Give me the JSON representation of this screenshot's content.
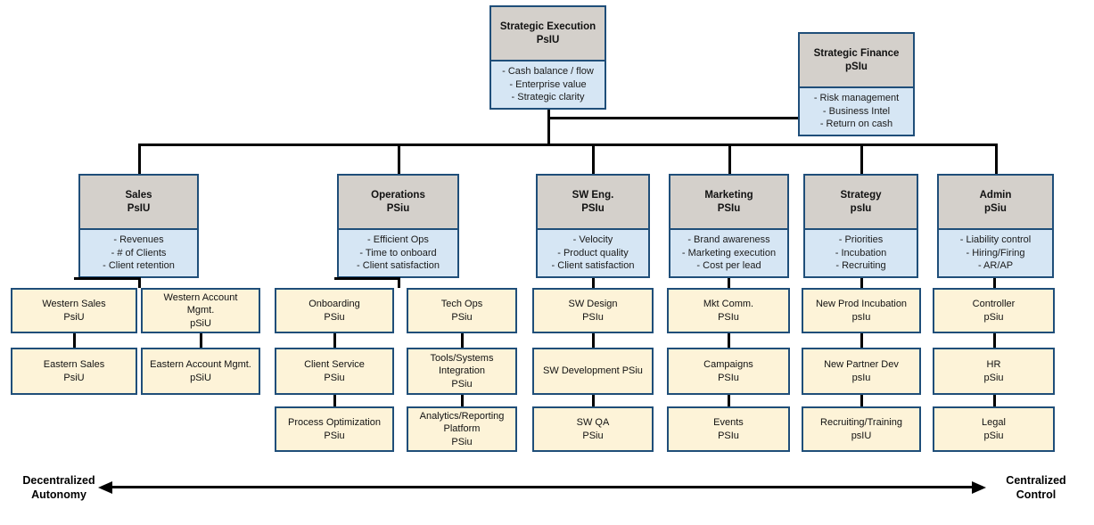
{
  "diagram": {
    "title": "Organizational accountability chart",
    "colors": {
      "border": "#1f4e79",
      "header_fill": "#d4d0cb",
      "body_fill": "#d6e6f4",
      "leaf_fill": "#fdf3d8",
      "line": "#000000",
      "background": "#ffffff"
    }
  },
  "top": {
    "execution": {
      "title": "Strategic Execution",
      "code": "PsIU",
      "metrics": [
        "- Cash balance / flow",
        "- Enterprise value",
        "- Strategic clarity"
      ]
    },
    "finance": {
      "title": "Strategic Finance",
      "code": "pSIu",
      "metrics": [
        "- Risk management",
        "- Business Intel",
        "- Return on cash"
      ]
    }
  },
  "departments": [
    {
      "title": "Sales",
      "code": "PsIU",
      "metrics": [
        "- Revenues",
        "- # of Clients",
        "- Client retention"
      ],
      "columns": [
        {
          "roles": [
            {
              "lines": [
                "Western Sales",
                "PsiU"
              ]
            },
            {
              "lines": [
                "Eastern Sales",
                "PsiU"
              ]
            }
          ]
        },
        {
          "roles": [
            {
              "lines": [
                "Western Account",
                "Mgmt.",
                "pSiU"
              ]
            },
            {
              "lines": [
                "Eastern Account Mgmt.",
                "pSiU"
              ]
            }
          ]
        }
      ]
    },
    {
      "title": "Operations",
      "code": "PSiu",
      "metrics": [
        "- Efficient Ops",
        "- Time to onboard",
        "- Client satisfaction"
      ],
      "columns": [
        {
          "roles": [
            {
              "lines": [
                "Onboarding",
                "PSiu"
              ]
            },
            {
              "lines": [
                "Client Service",
                "PSiu"
              ]
            },
            {
              "lines": [
                "Process Optimization",
                "PSiu"
              ]
            }
          ]
        },
        {
          "roles": [
            {
              "lines": [
                "Tech Ops",
                "PSiu"
              ]
            },
            {
              "lines": [
                "Tools/Systems",
                "Integration",
                "PSiu"
              ]
            },
            {
              "lines": [
                "Analytics/Reporting",
                "Platform",
                "PSiu"
              ]
            }
          ]
        }
      ]
    },
    {
      "title": "SW Eng.",
      "code": "PSIu",
      "metrics": [
        "- Velocity",
        "- Product quality",
        "- Client satisfaction"
      ],
      "columns": [
        {
          "roles": [
            {
              "lines": [
                "SW Design",
                "PSIu"
              ]
            },
            {
              "lines": [
                "SW Development PSiu"
              ]
            },
            {
              "lines": [
                "SW QA",
                "PSiu"
              ]
            }
          ]
        }
      ]
    },
    {
      "title": "Marketing",
      "code": "PSIu",
      "metrics": [
        "- Brand awareness",
        "- Marketing execution",
        "- Cost per lead"
      ],
      "columns": [
        {
          "roles": [
            {
              "lines": [
                "Mkt Comm.",
                "PSIu"
              ]
            },
            {
              "lines": [
                "Campaigns",
                "PSIu"
              ]
            },
            {
              "lines": [
                "Events",
                "PSIu"
              ]
            }
          ]
        }
      ]
    },
    {
      "title": "Strategy",
      "code": "psIu",
      "metrics": [
        "- Priorities",
        "- Incubation",
        "- Recruiting"
      ],
      "columns": [
        {
          "roles": [
            {
              "lines": [
                "New Prod Incubation",
                "psIu"
              ]
            },
            {
              "lines": [
                "New Partner Dev",
                "psIu"
              ]
            },
            {
              "lines": [
                "Recruiting/Training",
                "psIU"
              ]
            }
          ]
        }
      ]
    },
    {
      "title": "Admin",
      "code": "pSiu",
      "metrics": [
        "- Liability control",
        "- Hiring/Firing",
        "- AR/AP"
      ],
      "columns": [
        {
          "roles": [
            {
              "lines": [
                "Controller",
                "pSiu"
              ]
            },
            {
              "lines": [
                "HR",
                "pSiu"
              ]
            },
            {
              "lines": [
                "Legal",
                "pSiu"
              ]
            }
          ]
        }
      ]
    }
  ],
  "axis": {
    "left_label_line1": "Decentralized",
    "left_label_line2": "Autonomy",
    "right_label_line1": "Centralized",
    "right_label_line2": "Control"
  }
}
